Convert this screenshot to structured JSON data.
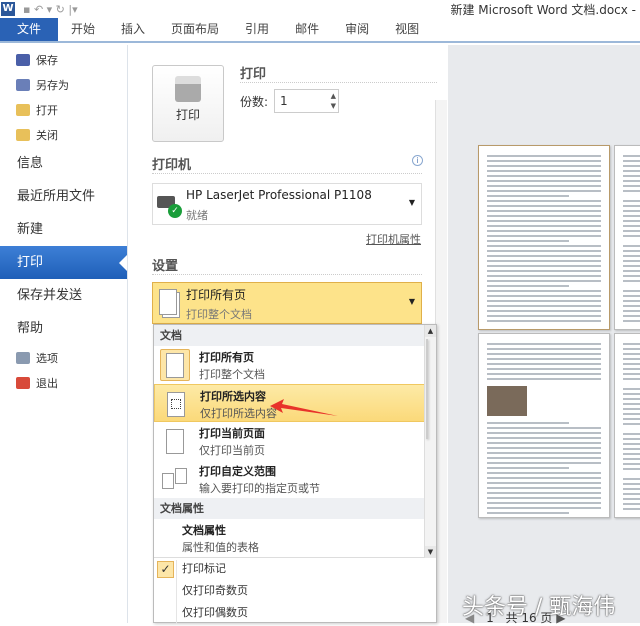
{
  "title": {
    "app_icon": "W",
    "document_title": "新建 Microsoft Word 文档.docx -"
  },
  "ribbon": {
    "tabs": [
      "文件",
      "开始",
      "插入",
      "页面布局",
      "引用",
      "邮件",
      "审阅",
      "视图"
    ]
  },
  "sidebar": {
    "small_items": [
      "保存",
      "另存为",
      "打开",
      "关闭"
    ],
    "big_items": [
      "信息",
      "最近所用文件",
      "新建",
      "打印",
      "保存并发送",
      "帮助"
    ],
    "bottom_items": [
      "选项",
      "退出"
    ],
    "active": "打印"
  },
  "print": {
    "button_label": "打印",
    "section_title": "打印",
    "copies_label": "份数:",
    "copies_value": "1"
  },
  "printer": {
    "section_title": "打印机",
    "name": "HP LaserJet Professional P1108",
    "status": "就绪",
    "properties_link": "打印机属性"
  },
  "settings": {
    "section_title": "设置",
    "selected_main": "打印所有页",
    "selected_sub": "打印整个文档"
  },
  "dropdown": {
    "group1": "文档",
    "items": [
      {
        "title": "打印所有页",
        "sub": "打印整个文档"
      },
      {
        "title": "打印所选内容",
        "sub": "仅打印所选内容"
      },
      {
        "title": "打印当前页面",
        "sub": "仅打印当前页"
      },
      {
        "title": "打印自定义范围",
        "sub": "输入要打印的指定页或节"
      }
    ],
    "group2": "文档属性",
    "prop_item": {
      "title": "文档属性",
      "sub": "属性和值的表格"
    },
    "options": [
      "打印标记",
      "仅打印奇数页",
      "仅打印偶数页"
    ],
    "checked_option": "打印标记"
  },
  "preview": {
    "current_page": "1",
    "total_pages": "共 16 页"
  },
  "watermark": "头条号 / 甄海伟",
  "colors": {
    "accent": "#2a62b5",
    "highlight": "#fde38a",
    "arrow": "#e8332a"
  }
}
